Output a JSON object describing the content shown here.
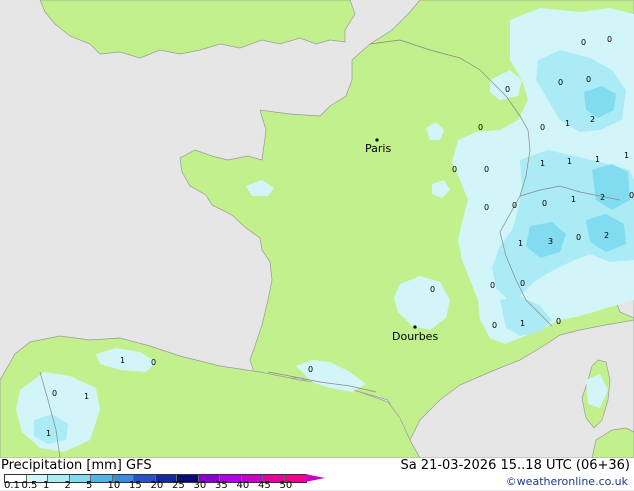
{
  "map": {
    "cities": [
      {
        "name": "Paris"
      },
      {
        "name": "Dourbes"
      }
    ],
    "precip_labels": [
      "0",
      "0",
      "0",
      "0",
      "0",
      "1",
      "2",
      "0",
      "0",
      "0",
      "1",
      "1",
      "1",
      "1",
      "0",
      "0",
      "0",
      "0",
      "1",
      "2",
      "3",
      "0",
      "1",
      "0",
      "2",
      "0",
      "0",
      "0",
      "0",
      "0",
      "1",
      "0",
      "1",
      "0",
      "0",
      "1",
      "1"
    ]
  },
  "legend": {
    "title": "Precipitation [mm]  GFS",
    "time": "Sa 21-03-2026 15..18 UTC (06+36)",
    "credit": "©weatheronline.co.uk",
    "ticks": [
      "0.1",
      "0.5",
      "1",
      "2",
      "5",
      "10",
      "15",
      "20",
      "25",
      "30",
      "35",
      "40",
      "45",
      "50"
    ],
    "colors": [
      "#ffffff",
      "#d2f5fa",
      "#aaebf5",
      "#82dcf0",
      "#50b4e6",
      "#3c8cdc",
      "#2850c8",
      "#1428a0",
      "#0a0a78",
      "#8c00d2",
      "#b400e6",
      "#c800c8",
      "#e600a0",
      "#f0008c"
    ]
  }
}
